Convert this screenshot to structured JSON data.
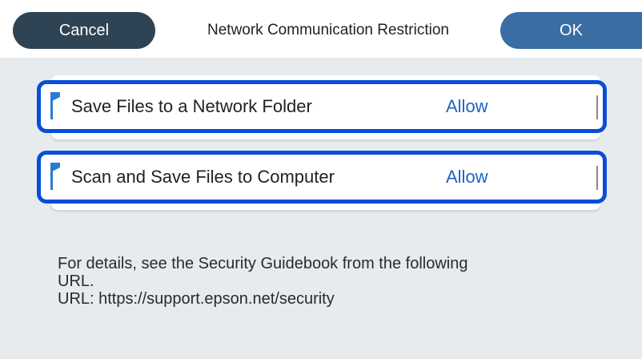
{
  "header": {
    "cancel_label": "Cancel",
    "title": "Network Communication Restriction",
    "ok_label": "OK"
  },
  "items": [
    {
      "label": "Save Files to a Network Folder",
      "value": "Allow"
    },
    {
      "label": "Scan and Save Files to Computer",
      "value": "Allow"
    }
  ],
  "details": {
    "line1": "For details, see the Security Guidebook from the following",
    "line2": "URL.",
    "line3": "URL: https://support.epson.net/security"
  },
  "colors": {
    "header_bg": "#ffffff",
    "cancel_bg": "#2e4454",
    "ok_bg": "#3a6da3",
    "content_bg": "#e8ebee",
    "selection_border": "#0a4dd8",
    "value_text": "#1d63c9",
    "flag": "#2a7ad6"
  },
  "icons": {
    "item_marker": "blue-flag-icon"
  }
}
